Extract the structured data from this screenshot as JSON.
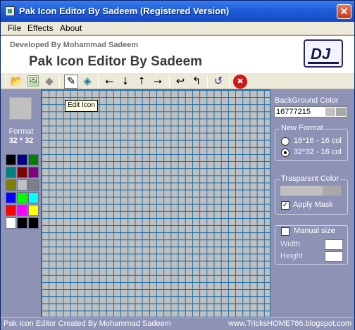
{
  "window": {
    "title": "Pak Icon Editor By Sadeem  (Registered Version)",
    "close_glyph": "✕"
  },
  "menu": [
    "File",
    "Effects",
    "About"
  ],
  "banner": {
    "developer": "Developed By Mohammad Sadeem",
    "app_name": "Pak Icon Editor By Sadeem",
    "logo_text": "DJ"
  },
  "toolbar": {
    "icons": [
      "open-folder-icon",
      "open-image-icon",
      "eraser-icon",
      "pencil-icon",
      "fill-bucket-icon",
      "arrow-left-icon",
      "arrow-down-icon",
      "arrow-up-icon",
      "arrow-right-icon",
      "flip-horizontal-icon",
      "flip-vertical-icon",
      "rotate-icon",
      "clear-icon"
    ],
    "glyphs": {
      "open": "📂",
      "image": "🖼",
      "eraser": "◆",
      "pencil": "✎",
      "fill": "◈",
      "left": "⭠",
      "down": "⭣",
      "up": "⭡",
      "right": "⭢",
      "flip_h": "↩",
      "flip_v": "↰",
      "rotate": "↺",
      "clear": "✖"
    },
    "tooltip": "Edit Icon"
  },
  "left_panel": {
    "format_label": "Format",
    "format_size": "32 * 32",
    "palette": [
      "#000000",
      "#000080",
      "#008000",
      "#008080",
      "#800000",
      "#800080",
      "#808000",
      "#c0c0c0",
      "#808080",
      "#0000ff",
      "#00ff00",
      "#00ffff",
      "#ff0000",
      "#ff00ff",
      "#ffff00",
      "#ffffff",
      "#000000",
      "#000000"
    ]
  },
  "canvas": {
    "grid_size": 32,
    "cell_color": "#c0c0c0",
    "line_color": "#1e6fa8"
  },
  "right_panel": {
    "background_color_label": "BackGround Color",
    "background_color_value": "16777215",
    "new_format_legend": "New Format",
    "format_option_1": "16*16 - 16 col",
    "format_option_2": "32*32 - 16 col",
    "selected_format": "32*32 - 16 col",
    "transparent_legend": "Trasparent Color",
    "apply_mask_label": "Apply Mask",
    "apply_mask_checked": true,
    "manual_size_label": "Manual size",
    "manual_size_checked": false,
    "width_label": "Width",
    "height_label": "Height"
  },
  "status": {
    "left": "Pak Icon Editor Created By Mohammad Sadeem",
    "right": "www.TricksHOME786.blogspot.com"
  },
  "colors": {
    "window_bg": "#8e93b6",
    "titlebar": "#1f5ed8",
    "close_button": "#c4391b"
  }
}
